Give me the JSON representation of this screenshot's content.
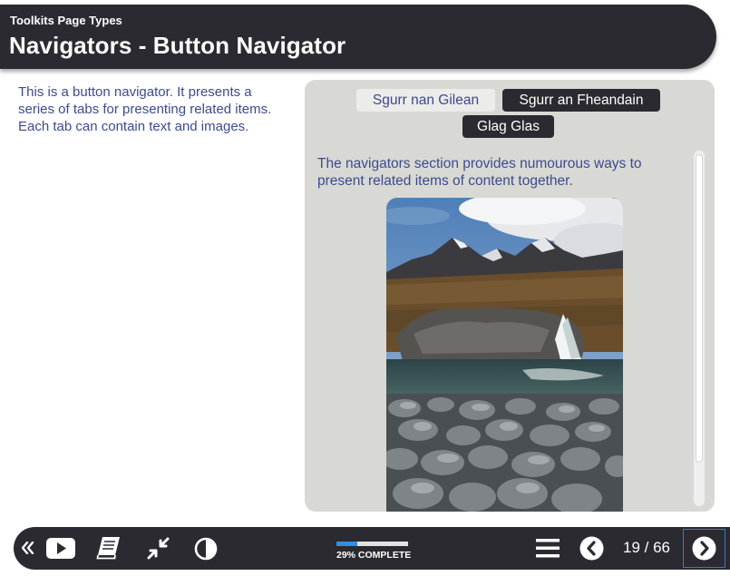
{
  "header": {
    "kicker": "Toolkits Page Types",
    "title": "Navigators - Button Navigator"
  },
  "intro": "This is a button navigator. It presents a series of tabs for presenting related items. Each tab can contain text and images.",
  "navigator": {
    "tabs": [
      {
        "label": "Sgurr nan Gilean",
        "state": "inactive"
      },
      {
        "label": "Sgurr an Fheandain",
        "state": "active"
      },
      {
        "label": "Glag Glas",
        "state": "active"
      }
    ],
    "content_text": "The navigators section provides numourous ways to present related items of content together."
  },
  "footer": {
    "icons": [
      "back-double-chevron-icon",
      "play-icon",
      "book-icon",
      "collapse-arrows-icon",
      "contrast-icon",
      "menu-icon",
      "previous-icon",
      "next-icon"
    ],
    "progress_percent": 29,
    "progress_label": "29% COMPLETE",
    "page_indicator": "19 / 66"
  },
  "colors": {
    "header_bg": "#2b2a30",
    "text_blue": "#3d4a8f",
    "panel_bg": "#d8d9d4",
    "progress_fill": "#2f8fe4",
    "focus_outline": "#3d73d8"
  }
}
